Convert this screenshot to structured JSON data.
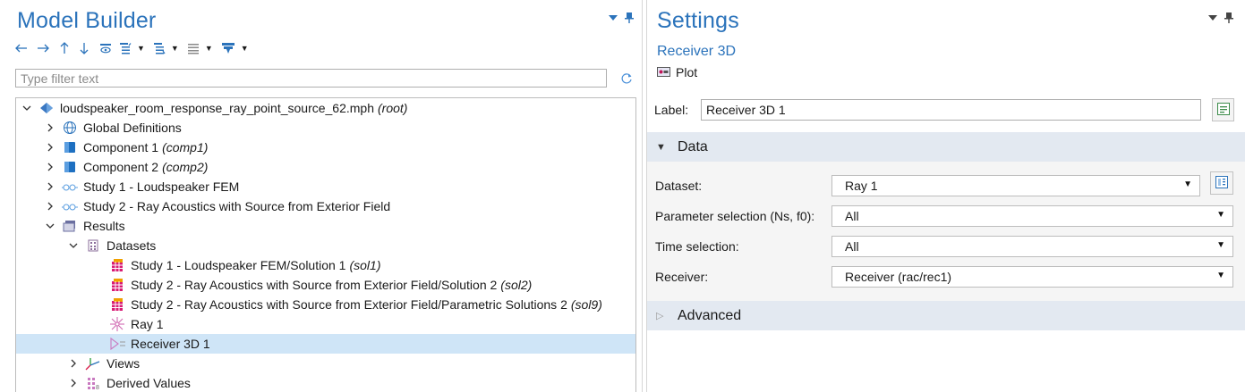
{
  "model_builder": {
    "title": "Model Builder",
    "filter_placeholder": "Type filter text",
    "toolbar": {
      "buttons": [
        "arrow-left-icon",
        "arrow-right-icon",
        "arrow-up-icon",
        "arrow-down-icon",
        "show-icon",
        "collapse-icon",
        "expand-icon",
        "list-icon",
        "filter-icon"
      ]
    },
    "tree": [
      {
        "label": "loudspeaker_room_response_ray_point_source_62.mph",
        "tag": "(root)",
        "icon": "model-root-icon",
        "expanded": true,
        "level": 0
      },
      {
        "label": "Global Definitions",
        "tag": "",
        "icon": "globe-icon",
        "expanded": false,
        "level": 1
      },
      {
        "label": "Component 1",
        "tag": "(comp1)",
        "icon": "component-icon",
        "expanded": false,
        "level": 1
      },
      {
        "label": "Component 2",
        "tag": "(comp2)",
        "icon": "component-icon",
        "expanded": false,
        "level": 1
      },
      {
        "label": "Study 1 - Loudspeaker FEM",
        "tag": "",
        "icon": "study-icon",
        "expanded": false,
        "level": 1
      },
      {
        "label": "Study 2 - Ray Acoustics with Source from Exterior Field",
        "tag": "",
        "icon": "study-icon",
        "expanded": false,
        "level": 1
      },
      {
        "label": "Results",
        "tag": "",
        "icon": "results-icon",
        "expanded": true,
        "level": 1
      },
      {
        "label": "Datasets",
        "tag": "",
        "icon": "datasets-icon",
        "expanded": true,
        "level": 2
      },
      {
        "label": "Study 1 - Loudspeaker FEM/Solution 1",
        "tag": "(sol1)",
        "icon": "solution-icon",
        "level": 3
      },
      {
        "label": "Study 2 - Ray Acoustics with Source from Exterior Field/Solution 2",
        "tag": "(sol2)",
        "icon": "solution-icon",
        "level": 3
      },
      {
        "label": "Study 2 - Ray Acoustics with Source from Exterior Field/Parametric Solutions 2",
        "tag": "(sol9)",
        "icon": "solution-icon",
        "level": 3
      },
      {
        "label": "Ray 1",
        "tag": "",
        "icon": "ray-icon",
        "level": 3
      },
      {
        "label": "Receiver 3D 1",
        "tag": "",
        "icon": "receiver-icon",
        "level": 3,
        "selected": true
      },
      {
        "label": "Views",
        "tag": "",
        "icon": "views-icon",
        "expanded": false,
        "level": 2
      },
      {
        "label": "Derived Values",
        "tag": "",
        "icon": "derived-values-icon",
        "expanded": false,
        "level": 2
      }
    ]
  },
  "settings": {
    "title": "Settings",
    "subtitle": "Receiver 3D",
    "type_label": "Plot",
    "label_caption": "Label:",
    "label_value": "Receiver 3D 1",
    "data_section": {
      "title": "Data",
      "fields": [
        {
          "caption": "Dataset:",
          "value": "Ray 1"
        },
        {
          "caption": "Parameter selection (Ns, f0):",
          "value": "All"
        },
        {
          "caption": "Time selection:",
          "value": "All"
        },
        {
          "caption": "Receiver:",
          "value": "Receiver (rac/rec1)"
        }
      ]
    },
    "advanced_section": {
      "title": "Advanced"
    }
  },
  "colors": {
    "accent": "#2b73bb",
    "selection": "#cfe5f7",
    "section_header": "#e3e9f1"
  }
}
